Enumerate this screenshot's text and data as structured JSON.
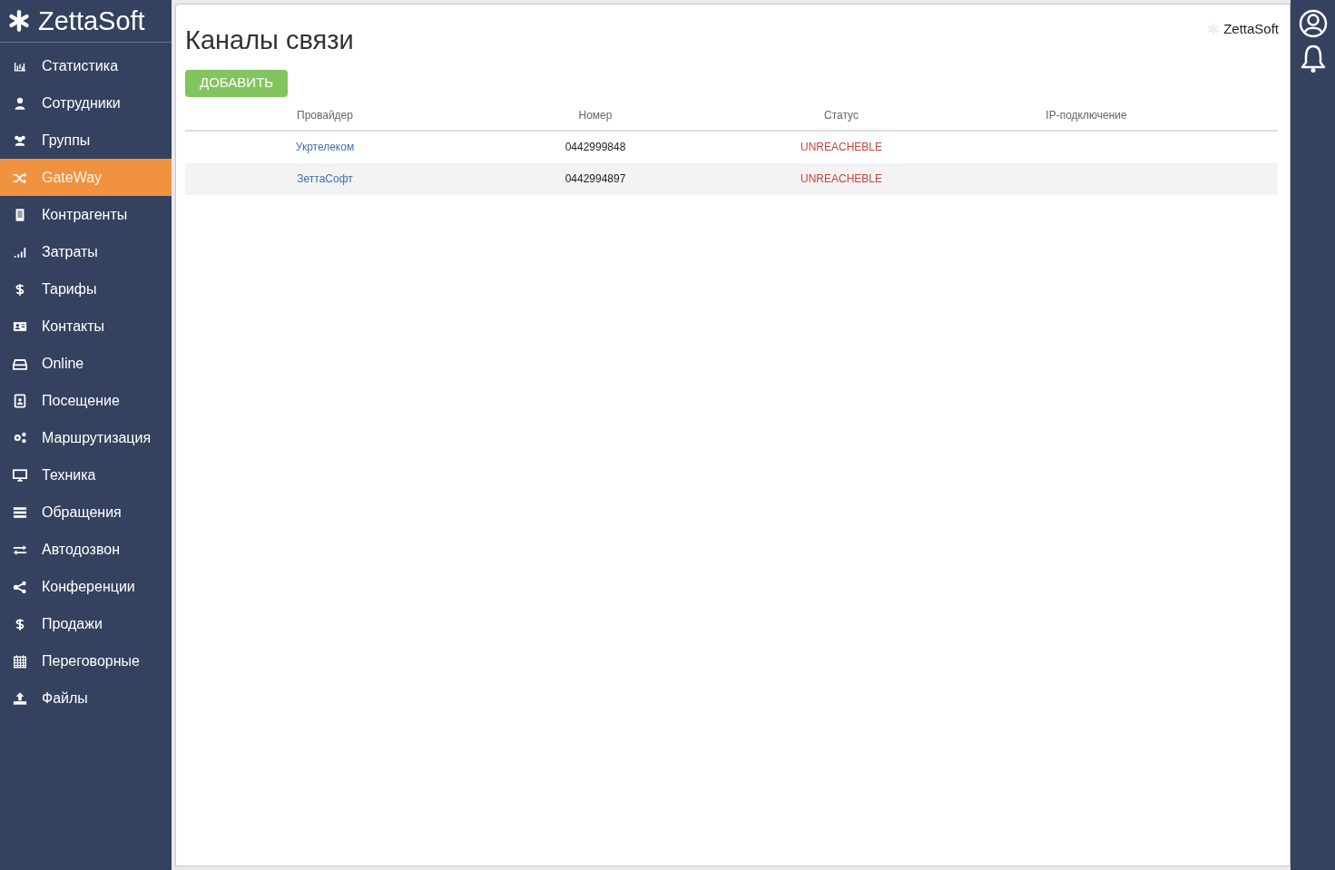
{
  "sidebar": {
    "logo": "ZettaSoft",
    "items": [
      {
        "label": "Статистика",
        "selected": false
      },
      {
        "label": "Сотрудники",
        "selected": false
      },
      {
        "label": "Группы",
        "selected": false
      },
      {
        "label": "GateWay",
        "selected": true
      },
      {
        "label": "Контрагенты",
        "selected": false
      },
      {
        "label": "Затраты",
        "selected": false
      },
      {
        "label": "Тарифы",
        "selected": false
      },
      {
        "label": "Контакты",
        "selected": false
      },
      {
        "label": "Online",
        "selected": false
      },
      {
        "label": "Посещение",
        "selected": false
      },
      {
        "label": "Маршрутизация",
        "selected": false
      },
      {
        "label": "Техника",
        "selected": false
      },
      {
        "label": "Обращения",
        "selected": false
      },
      {
        "label": "Автодозвон",
        "selected": false
      },
      {
        "label": "Конференции",
        "selected": false
      },
      {
        "label": "Продажи",
        "selected": false
      },
      {
        "label": "Переговорные",
        "selected": false
      },
      {
        "label": "Файлы",
        "selected": false
      }
    ]
  },
  "page": {
    "title": "Каналы связи",
    "brand": "ZettaSoft",
    "add_button": "ДОБАВИТЬ"
  },
  "table": {
    "columns": [
      "Провайдер",
      "Номер",
      "Статус",
      "IP-подключение"
    ],
    "rows": [
      {
        "provider": "Укртелеком",
        "number": "0442999848",
        "status": "UNREACHEBLE"
      },
      {
        "provider": "ЗеттаСофт",
        "number": "0442994897",
        "status": "UNREACHEBLE"
      }
    ]
  }
}
